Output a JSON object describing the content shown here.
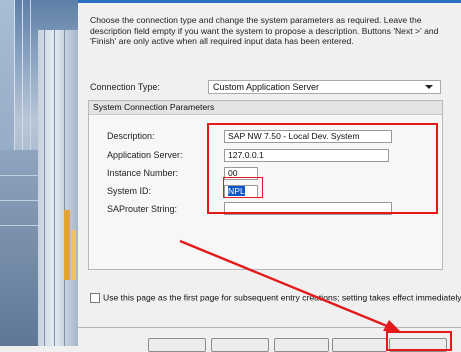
{
  "instructions": "Choose the connection type and change the system parameters as required. Leave the description field empty if you want the system to propose a description. Buttons 'Next >' and 'Finish' are only active when all required input data has been entered.",
  "connection_type": {
    "label": "Connection Type:",
    "value": "Custom Application Server"
  },
  "group": {
    "title": "System Connection Parameters",
    "fields": {
      "description": {
        "label": "Description:",
        "value": "SAP NW 7.50 - Local Dev. System"
      },
      "application_server": {
        "label": "Application Server:",
        "value": "127.0.0.1"
      },
      "instance_number": {
        "label": "Instance Number:",
        "value": "00"
      },
      "system_id": {
        "label": "System ID:",
        "value": "NPL"
      },
      "saprouter": {
        "label": "SAProuter String:",
        "value": ""
      }
    }
  },
  "first_page_checkbox": {
    "checked": false,
    "label": "Use this page as the first page for subsequent entry creations; setting takes effect immediately"
  },
  "annotation_color": "#e21a1a",
  "icons": [
    "chevron-down-icon",
    "checkbox-icon",
    "annotation-arrow"
  ]
}
